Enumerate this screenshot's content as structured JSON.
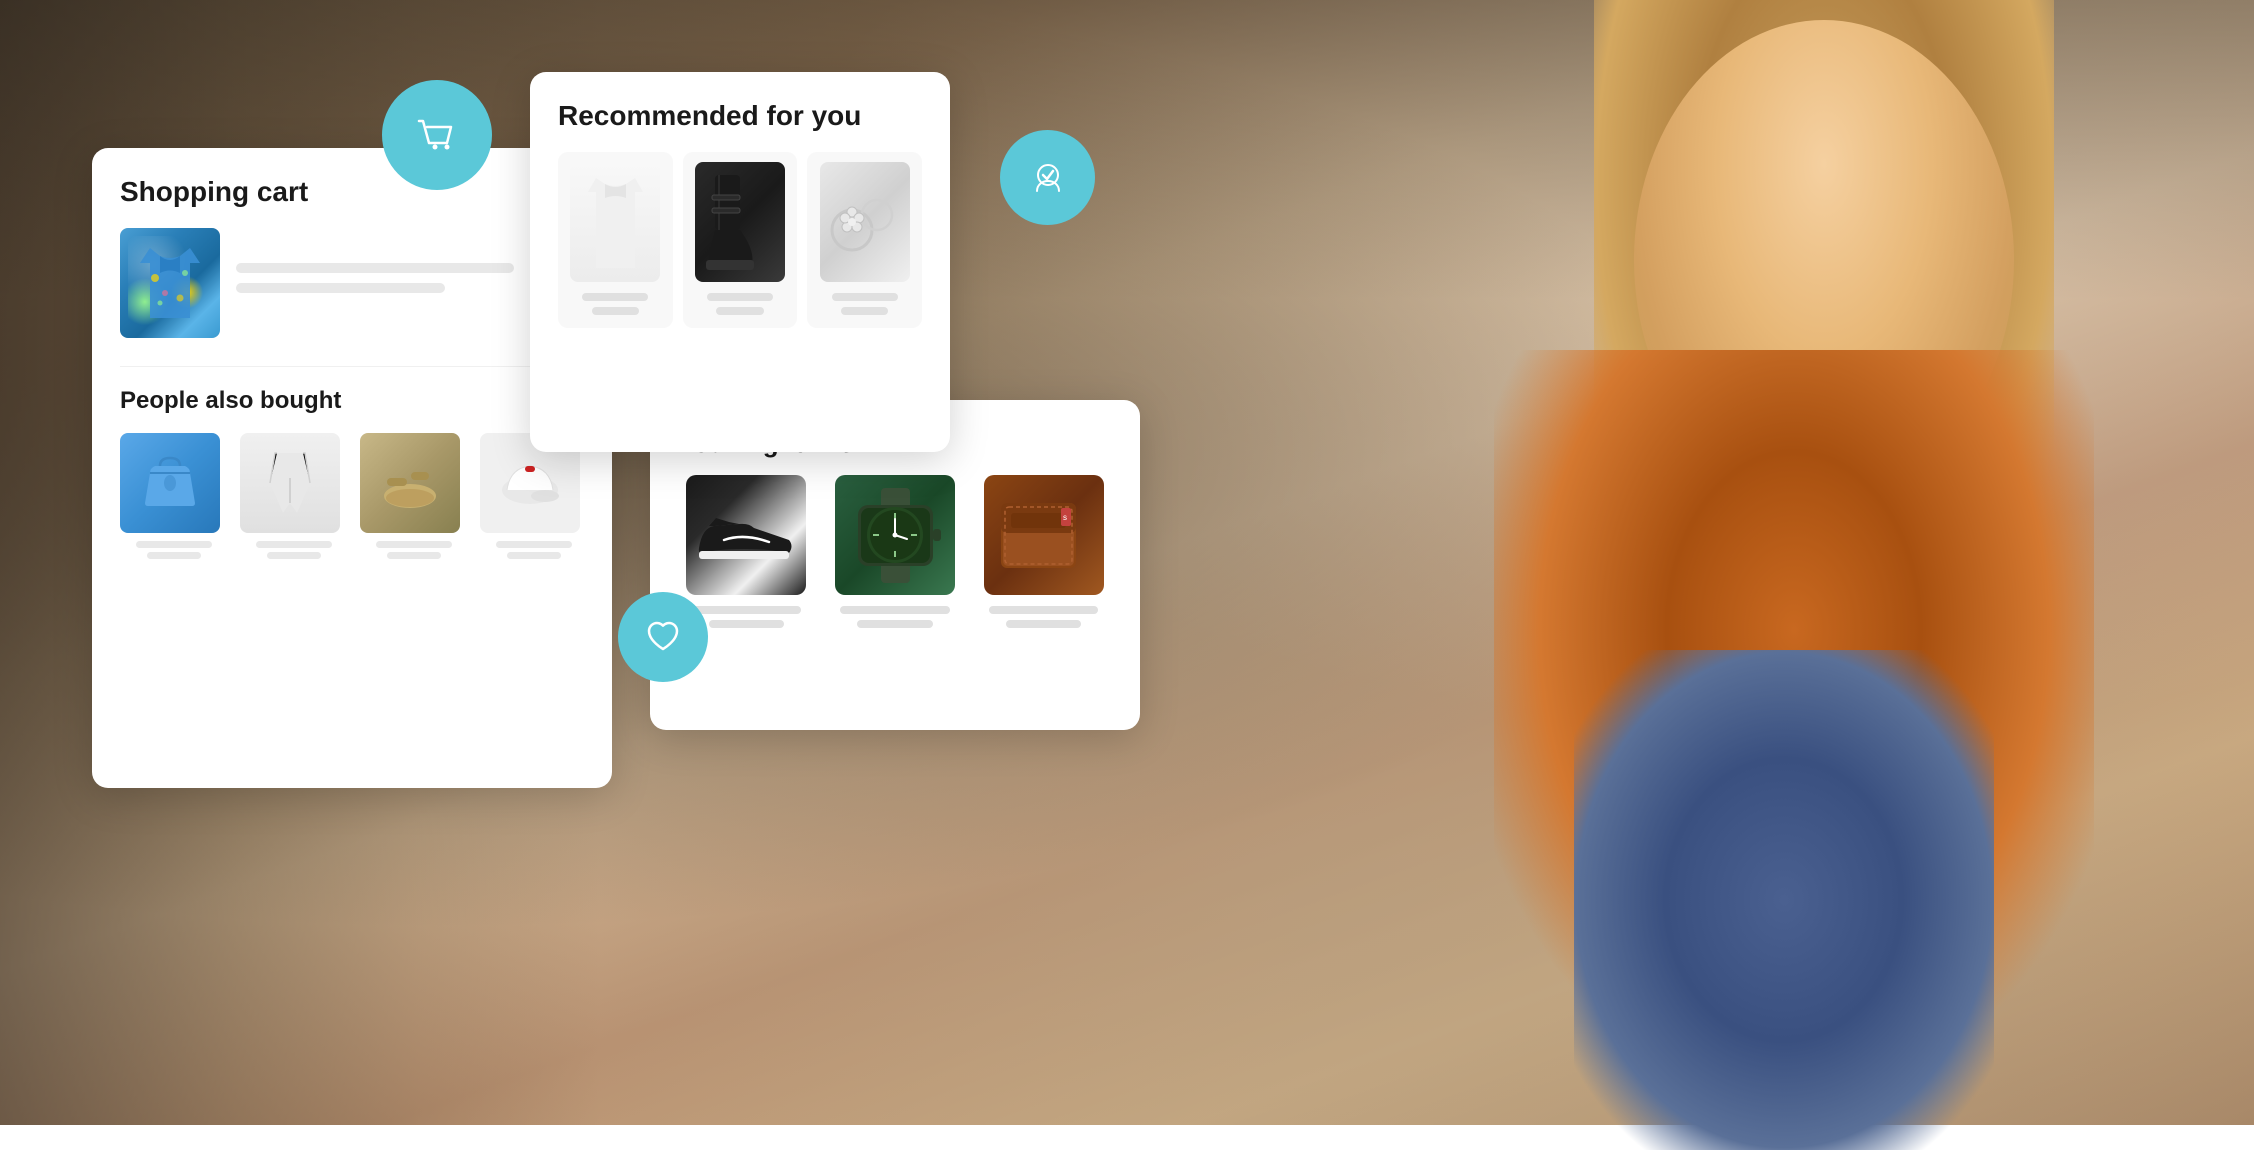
{
  "background": {
    "color": "#b8966a"
  },
  "floating_icons": {
    "cart_icon": "cart",
    "verify_icon": "verify",
    "heart_icon": "heart"
  },
  "shopping_cart_card": {
    "title": "Shopping cart",
    "item": {
      "image_desc": "Hawaiian floral shirt, blue",
      "line1_width": "75%",
      "line2_width": "55%"
    }
  },
  "people_also_bought": {
    "title": "People also bought",
    "products": [
      {
        "image_desc": "Blue handbag",
        "type": "bag"
      },
      {
        "image_desc": "White wide-leg pants",
        "type": "pants"
      },
      {
        "image_desc": "Beige sandals/slippers",
        "type": "sandals"
      },
      {
        "image_desc": "Red white cap",
        "type": "cap"
      }
    ]
  },
  "recommended_card": {
    "title": "Recommended for you",
    "products": [
      {
        "image_desc": "White blouse/top",
        "type": "white_top"
      },
      {
        "image_desc": "Black ankle boots",
        "type": "boots"
      },
      {
        "image_desc": "Silver flower rings",
        "type": "rings"
      }
    ]
  },
  "you_might_like_card": {
    "title": "You might like",
    "heart_icon": "❤",
    "products": [
      {
        "image_desc": "Black Nike sneakers",
        "type": "sneakers"
      },
      {
        "image_desc": "Green/teal watch with leather strap",
        "type": "watch"
      },
      {
        "image_desc": "Brown leather wallet",
        "type": "wallet"
      }
    ]
  }
}
